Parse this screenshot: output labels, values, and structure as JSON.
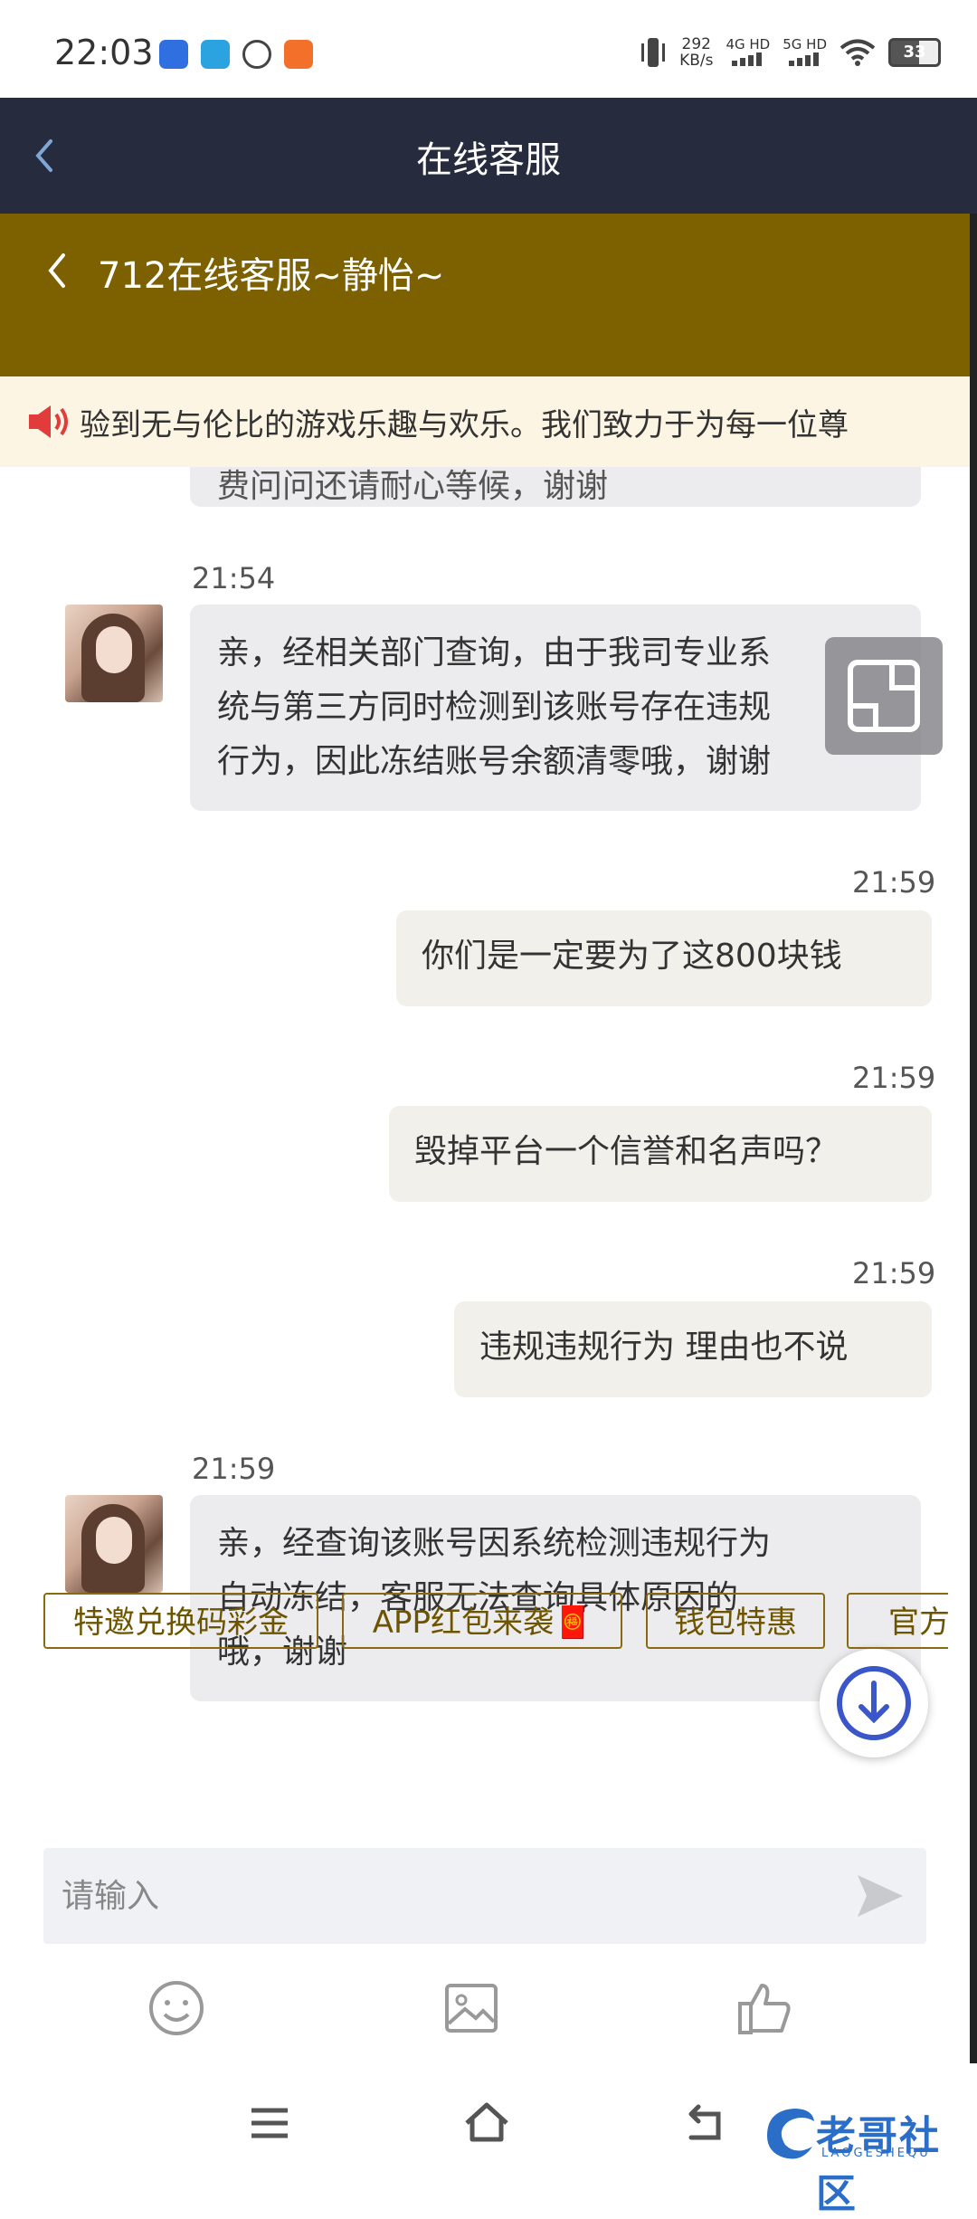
{
  "status_bar": {
    "time": "22:03",
    "speed_value": "292",
    "speed_unit": "KB/s",
    "net1": "4G HD",
    "net2": "5G HD",
    "battery": "33"
  },
  "app_bar": {
    "title": "在线客服"
  },
  "cs_header": {
    "title": "712在线客服~静怡~"
  },
  "marquee": {
    "text": "验到无与伦比的游戏乐趣与欢乐。我们致力于为每一位尊"
  },
  "partial_message": {
    "text": "费问问还请耐心等候，谢谢"
  },
  "messages": [
    {
      "side": "left",
      "time": "21:54",
      "lines": [
        "亲，经相关部门查询，由于我司专业系",
        "统与第三方同时检测到该账号存在违规",
        "行为，因此冻结账号余额清零哦，谢谢"
      ]
    },
    {
      "side": "right",
      "time": "21:59",
      "text": "你们是一定要为了这800块钱"
    },
    {
      "side": "right",
      "time": "21:59",
      "text": "毁掉平台一个信誉和名声吗？"
    },
    {
      "side": "right",
      "time": "21:59",
      "text": "违规违规行为 理由也不说"
    },
    {
      "side": "left",
      "time": "21:59",
      "lines": [
        "亲，经查询该账号因系统检测违规行为",
        "自动冻结，客服无法查询具体原因的",
        "哦，谢谢"
      ]
    }
  ],
  "quick_replies": [
    "特邀兑换码彩金",
    "APP红包来袭🧧",
    "钱包特惠",
    "官方"
  ],
  "input": {
    "placeholder": "请输入"
  },
  "toolbar": {
    "icons": [
      "emoji-icon",
      "image-icon",
      "thumbs-up-icon"
    ]
  },
  "watermark": {
    "text": "老哥社区",
    "sub": "LAOGESHEQU"
  },
  "colors": {
    "appbar": "#262c3d",
    "cs_header": "#7d6100",
    "marquee_bg": "#fdf5e3",
    "accent": "#6d5400"
  }
}
